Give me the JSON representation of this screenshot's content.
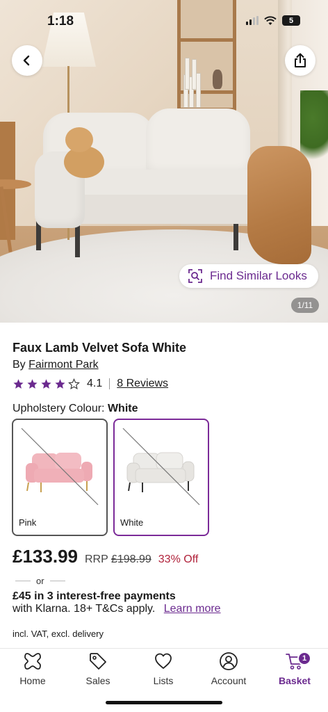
{
  "status_bar": {
    "time": "1:18",
    "battery": "5"
  },
  "hero": {
    "similar_label": "Find Similar Looks",
    "image_counter": "1/11"
  },
  "product": {
    "title": "Faux Lamb Velvet Sofa White",
    "by_prefix": "By",
    "brand": "Fairmont Park",
    "rating": "4.1",
    "stars": 4,
    "reviews": "8 Reviews"
  },
  "upholstery": {
    "label": "Upholstery Colour:",
    "selected": "White",
    "options": [
      {
        "name": "Pink",
        "color": "#f1b6bd",
        "leg_color": "#c8a050",
        "selected": false
      },
      {
        "name": "White",
        "color": "#ecebe8",
        "leg_color": "#333333",
        "selected": true
      }
    ]
  },
  "price": {
    "current": "£133.99",
    "rrp_label": "RRP",
    "rrp_value": "£198.99",
    "discount": "33% Off"
  },
  "klarna": {
    "or": "or",
    "line1": "£45 in 3 interest-free payments",
    "line2": "with Klarna. 18+ T&Cs apply.",
    "learn_more": "Learn more"
  },
  "vat_note": "incl. VAT, excl. delivery",
  "nav": {
    "items": [
      {
        "label": "Home",
        "icon": "home-icon"
      },
      {
        "label": "Sales",
        "icon": "tag-icon"
      },
      {
        "label": "Lists",
        "icon": "heart-icon"
      },
      {
        "label": "Account",
        "icon": "account-icon"
      },
      {
        "label": "Basket",
        "icon": "basket-icon",
        "active": true,
        "badge": "1"
      }
    ]
  },
  "colors": {
    "accent": "#6b2a8f",
    "discount": "#b0213a",
    "star": "#6b2a8f"
  }
}
